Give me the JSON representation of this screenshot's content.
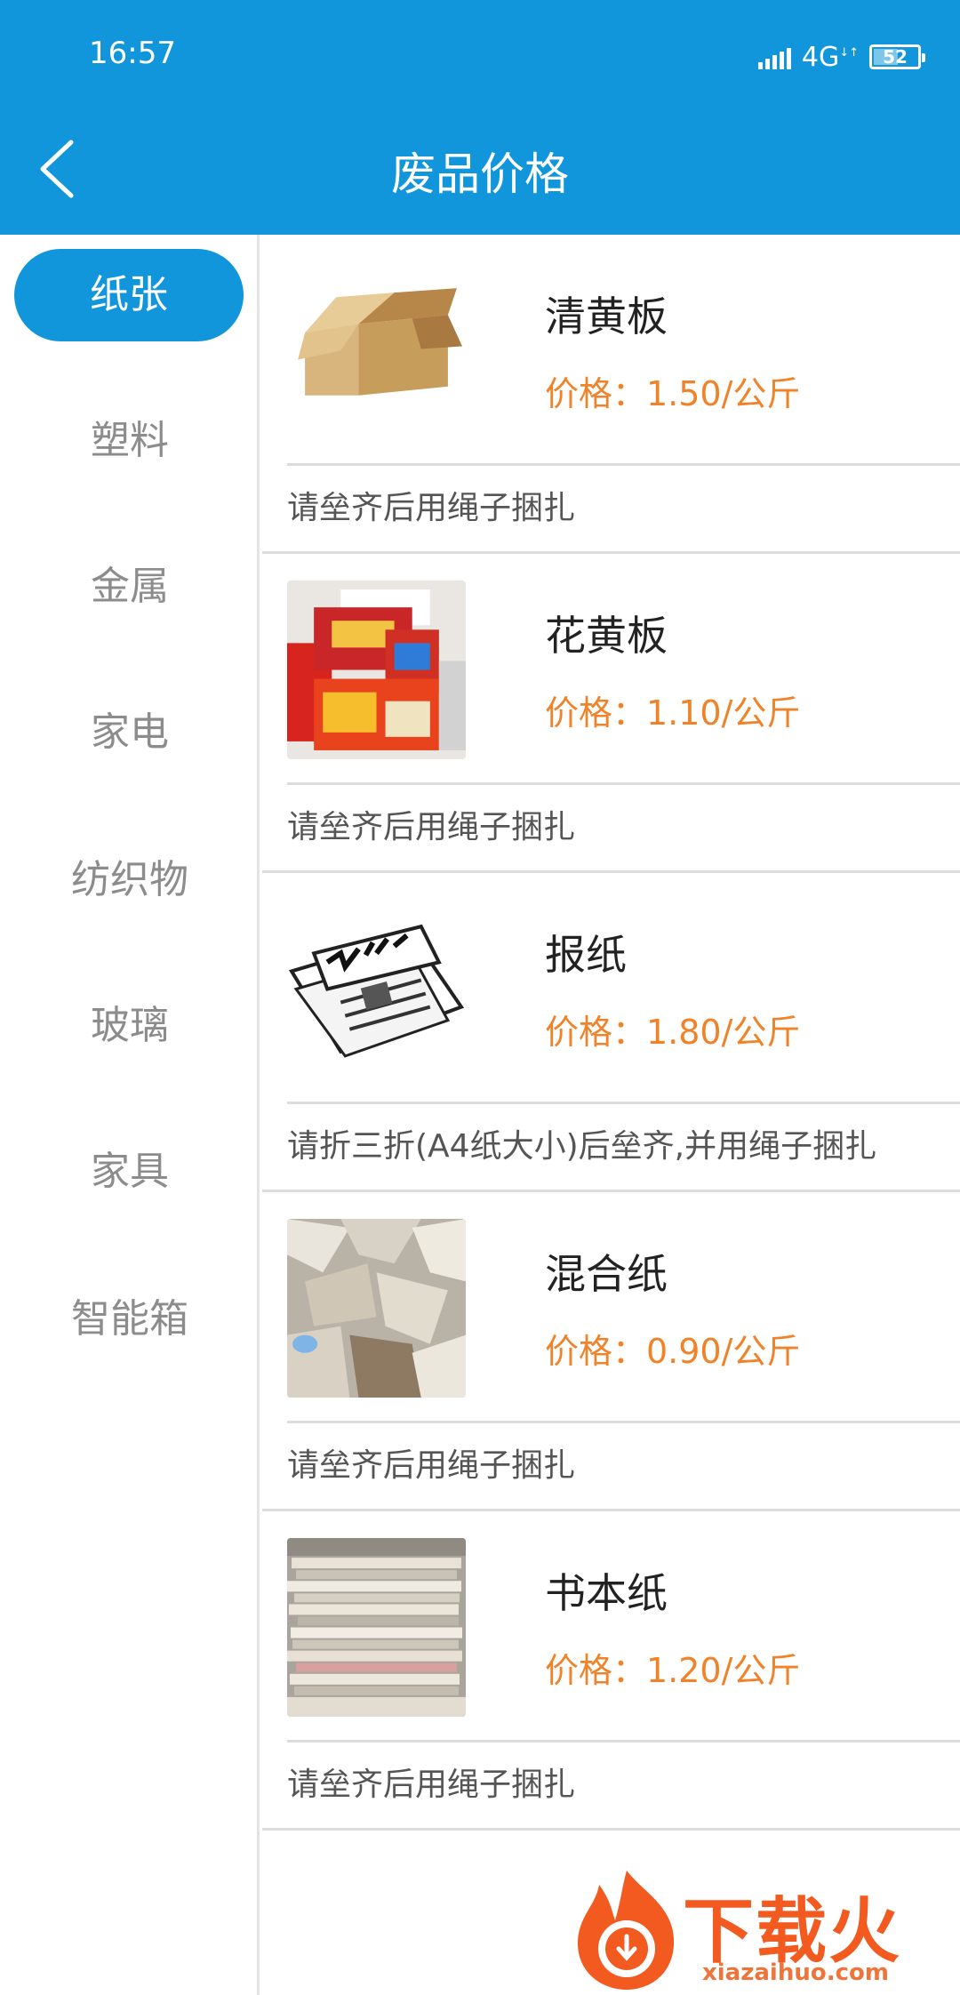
{
  "status_bar": {
    "time": "16:57",
    "network": "4G",
    "battery": "52",
    "battery_level": 0.52
  },
  "header": {
    "title": "废品价格"
  },
  "categories": [
    {
      "label": "纸张",
      "active": true
    },
    {
      "label": "塑料",
      "active": false
    },
    {
      "label": "金属",
      "active": false
    },
    {
      "label": "家电",
      "active": false
    },
    {
      "label": "纺织物",
      "active": false
    },
    {
      "label": "玻璃",
      "active": false
    },
    {
      "label": "家具",
      "active": false
    },
    {
      "label": "智能箱",
      "active": false
    }
  ],
  "items": [
    {
      "name": "清黄板",
      "price": "价格：1.50/公斤",
      "note": "请垒齐后用绳子捆扎",
      "image": "cardboard-box"
    },
    {
      "name": "花黄板",
      "price": "价格：1.10/公斤",
      "note": "请垒齐后用绳子捆扎",
      "image": "printed-boxes"
    },
    {
      "name": "报纸",
      "price": "价格：1.80/公斤",
      "note": "请折三折(A4纸大小)后垒齐,并用绳子捆扎",
      "image": "newspaper"
    },
    {
      "name": "混合纸",
      "price": "价格：0.90/公斤",
      "note": "请垒齐后用绳子捆扎",
      "image": "mixed-paper"
    },
    {
      "name": "书本纸",
      "price": "价格：1.20/公斤",
      "note": "请垒齐后用绳子捆扎",
      "image": "book-stack"
    }
  ],
  "watermark": {
    "brand": "下载火",
    "domain": "xiazaihuo.com"
  },
  "colors": {
    "primary": "#1196db",
    "price": "#f0832a",
    "inactive_text": "#8c8c8c",
    "watermark": "#f25a1f"
  }
}
